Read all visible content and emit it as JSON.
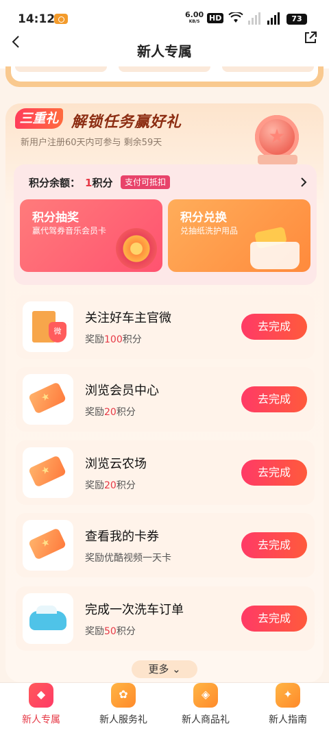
{
  "status_bar": {
    "time": "14:12",
    "net_rate": "6.00",
    "net_unit": "KB/S",
    "hd": "HD",
    "battery": "73"
  },
  "nav": {
    "title": "新人专属"
  },
  "promo": {
    "badge": "三重礼",
    "title": "解锁任务赢好礼",
    "subtitle": "新用户注册60天内可参与 剩余59天"
  },
  "points": {
    "label": "积分余额：",
    "value": "1",
    "unit": "积分",
    "tag": "支付可抵扣"
  },
  "tiles": [
    {
      "title": "积分抽奖",
      "subtitle": "赢代驾券音乐会员卡"
    },
    {
      "title": "积分兑换",
      "subtitle": "兑抽纸洗护用品"
    }
  ],
  "tasks": [
    {
      "name": "关注好车主官微",
      "reward_prefix": "奖励",
      "reward_value": "100",
      "reward_suffix": "积分",
      "button": "去完成",
      "icon": "wechat-official-icon"
    },
    {
      "name": "浏览会员中心",
      "reward_prefix": "奖励",
      "reward_value": "20",
      "reward_suffix": "积分",
      "button": "去完成",
      "icon": "ticket-icon"
    },
    {
      "name": "浏览云农场",
      "reward_prefix": "奖励",
      "reward_value": "20",
      "reward_suffix": "积分",
      "button": "去完成",
      "icon": "ticket-icon"
    },
    {
      "name": "查看我的卡券",
      "reward_prefix": "奖励优酷视频一天卡",
      "reward_value": "",
      "reward_suffix": "",
      "button": "去完成",
      "icon": "ticket-icon"
    },
    {
      "name": "完成一次洗车订单",
      "reward_prefix": "奖励",
      "reward_value": "50",
      "reward_suffix": "积分",
      "button": "去完成",
      "icon": "car-wash-icon"
    }
  ],
  "more_label": "更多",
  "tabbar": [
    {
      "label": "新人专属",
      "active": true
    },
    {
      "label": "新人服务礼",
      "active": false
    },
    {
      "label": "新人商品礼",
      "active": false
    },
    {
      "label": "新人指南",
      "active": false
    }
  ]
}
